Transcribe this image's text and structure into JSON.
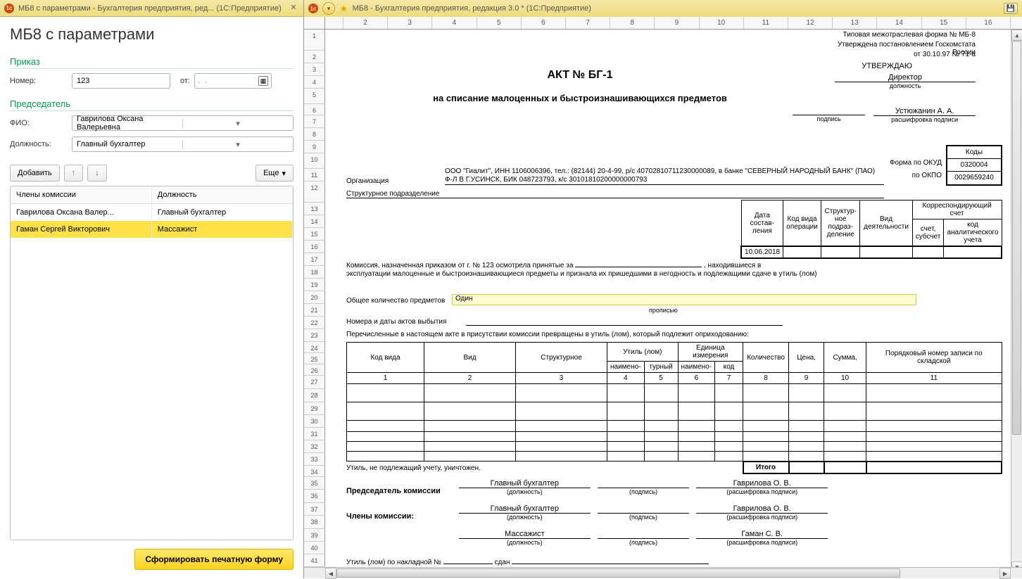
{
  "left": {
    "titlebar": "МБ8 с параметрами - Бухгалтерия предприятия, ред...   (1С:Предприятие)",
    "heading": "МБ8 с параметрами",
    "section_prikaz": "Приказ",
    "label_number": "Номер:",
    "number_value": "123",
    "label_from": "от:",
    "date_placeholder": ". .",
    "section_chair": "Председатель",
    "label_fio": "ФИО:",
    "fio_value": "Гаврилова Оксана Валерьевна",
    "label_position": "Должность:",
    "position_value": "Главный бухгалтер",
    "btn_add": "Добавить",
    "btn_more": "Еще",
    "col_members": "Члены комиссии",
    "col_position": "Должность",
    "rows": [
      {
        "name": "Гаврилова Оксана Валер...",
        "pos": "Главный бухгалтер"
      },
      {
        "name": "Гаман Сергей Викторович",
        "pos": "Массажист"
      }
    ],
    "btn_generate": "Сформировать печатную форму"
  },
  "right": {
    "titlebar": "МБ8 - Бухгалтерия предприятия, редакция 3.0 *  (1С:Предприятие)",
    "columns": [
      "2",
      "3",
      "4",
      "5",
      "6",
      "7",
      "8",
      "9",
      "10",
      "11",
      "12",
      "13",
      "14",
      "15",
      "16"
    ],
    "rows_range": 41,
    "form_header1": "Типовая межотраслевая форма № МБ-8",
    "form_header2": "Утверждена постановлением Госкомстата России",
    "form_header3": "от 30.10.97 № 71-а",
    "approve": "УТВЕРЖДАЮ",
    "director": "Директор",
    "position_lbl": "должность",
    "signature_lbl": "подпись",
    "decipher": "расшифровка подписи",
    "approver_name": "Устюжанин А. А.",
    "act_title": "АКТ № БГ-1",
    "act_sub": "на списание малоценных и быстроизнашивающихся предметов",
    "codes_header": "Коды",
    "form_okud_lbl": "Форма по ОКУД",
    "okud": "0320004",
    "okpo_lbl": "по ОКПО",
    "okpo": "0029659240",
    "org_label": "Организация",
    "org_text": "ООО \"Гиалит\", ИНН 1106006396, тел.: (82144) 20-4-99, р/с 40702810711230000089, в банке \"СЕВЕРНЫЙ НАРОДНЫЙ БАНК\" (ПАО) Ф-Л В Г.УСИНСК, БИК 048723793, к/с 30101810200000000793",
    "struct_label": "Структурное подразделение",
    "tbl_hdr": [
      "Дата состав-ления",
      "Код вида операции",
      "Структур-ное подраз-деление",
      "Вид деятельности",
      "Корреспондирующий счет"
    ],
    "tbl_sub": [
      "счет, субсчет",
      "код аналитического учета"
    ],
    "date_value": "10.06.2018",
    "komissia_text1": "Комиссия, назначенная приказом от  г.  № 123  осмотрела принятые за",
    "komissia_text1b": ", находившиеся в",
    "komissia_text2": "эксплуатации малоценные и быстроизнашивающиеся предметы и признала их пришедшими в негодность и подлежащими сдаче в утиль (лом)",
    "total_items_lbl": "Общее количество предметов",
    "total_items_val": "Один",
    "propis": "прописью",
    "acts_out": "Номера и даты актов выбытия",
    "listed": "Перечисленные в настоящем акте в присутствии комиссии превращены в утиль (лом), который подлежит оприходованию:",
    "main_tbl_hdr1": [
      "Код вида",
      "Вид",
      "Структурное",
      "Утиль (лом)",
      "Единица измерения",
      "Количество",
      "Цена,",
      "Сумма,",
      "Порядковый номер записи по складской"
    ],
    "main_tbl_hdr2": [
      "наимено-",
      "турный",
      "наимено-",
      "код"
    ],
    "main_tbl_nums": [
      "1",
      "2",
      "3",
      "4",
      "5",
      "6",
      "7",
      "8",
      "9",
      "10",
      "11"
    ],
    "itogo": "Итого",
    "util_not_acc": "Утиль, не подлежащий учету, уничтожен.",
    "chair_comm": "Председатель комиссии",
    "members_comm": "Члены комиссии:",
    "pos_small": "(должность)",
    "sign_small": "(подпись)",
    "decipher_small": "(расшифровка подписи)",
    "sig_rows": [
      {
        "pos": "Главный бухгалтер",
        "name": "Гаврилова О. В."
      },
      {
        "pos": "Главный бухгалтер",
        "name": "Гаврилова О. В."
      },
      {
        "pos": "Массажист",
        "name": "Гаман С. В."
      }
    ],
    "util_waybill": "Утиль (лом) по накладной №",
    "sdan": "сдан"
  }
}
